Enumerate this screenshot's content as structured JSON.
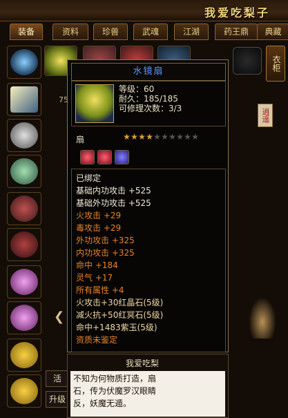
{
  "window": {
    "title": "我爱吃梨子"
  },
  "tabs": [
    {
      "label": "装备"
    },
    {
      "label": "资料"
    },
    {
      "label": "珍兽"
    },
    {
      "label": "武魂"
    },
    {
      "label": "江湖"
    },
    {
      "label": "药王鼎"
    },
    {
      "label": "典藏"
    }
  ],
  "side_buttons": {
    "clothes": "衣柜",
    "xiaoyao": "逍遥"
  },
  "left_number": "75",
  "tooltip": {
    "name": "水镜扇",
    "level": "等级：60",
    "durability": "耐久：185/185",
    "repairs": "可修理次数：3/3",
    "type": "扇",
    "stars_filled": 4,
    "stars_total": 10,
    "gems": [
      "red-gem",
      "red-gem",
      "purple-gem"
    ],
    "attributes": [
      {
        "text": "已绑定",
        "color": "white"
      },
      {
        "text": "基础内功攻击 +525",
        "color": "white"
      },
      {
        "text": "基础外功攻击 +525",
        "color": "white"
      },
      {
        "text": "火攻击 +29",
        "color": "orange"
      },
      {
        "text": "毒攻击 +29",
        "color": "orange"
      },
      {
        "text": "外功攻击 +325",
        "color": "orange"
      },
      {
        "text": "内功攻击 +325",
        "color": "orange"
      },
      {
        "text": "命中 +184",
        "color": "orange"
      },
      {
        "text": "灵气 +17",
        "color": "orange"
      },
      {
        "text": "所有属性 +4",
        "color": "orange"
      },
      {
        "text": "火攻击+30红晶石(5级)",
        "color": "beige"
      },
      {
        "text": "减火抗+50红冥石(5级)",
        "color": "beige"
      },
      {
        "text": "命中+1483紫玉(5级)",
        "color": "beige"
      },
      {
        "text": "资质未鉴定",
        "color": "orange"
      }
    ]
  },
  "desc_panel": {
    "title": "我爱吃梨",
    "text_lines": [
      "不知为何物质打造，扇",
      "石，传为伏魔罗汉眼睛",
      "反，妖魔无遁。"
    ]
  },
  "bottom_buttons": {
    "btn1": "活",
    "btn2": "升级"
  },
  "colors": {
    "name_blue": "#5f94ff",
    "attr_orange": "#e8842a",
    "gold": "#f0d47a"
  }
}
